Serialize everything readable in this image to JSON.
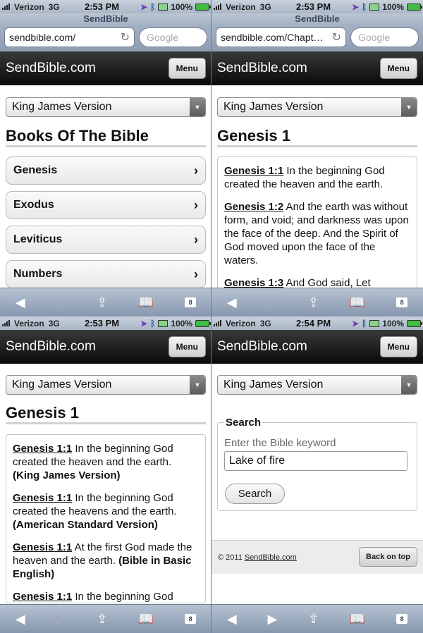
{
  "status": [
    {
      "carrier": "Verizon",
      "network": "3G",
      "time": "2:53 PM",
      "battery": "100%"
    },
    {
      "carrier": "Verizon",
      "network": "3G",
      "time": "2:53 PM",
      "battery": "100%"
    },
    {
      "carrier": "Verizon",
      "network": "3G",
      "time": "2:53 PM",
      "battery": "100%"
    },
    {
      "carrier": "Verizon",
      "network": "3G",
      "time": "2:54 PM",
      "battery": "100%"
    }
  ],
  "browser": [
    {
      "title": "SendBible",
      "url": "sendbible.com/",
      "search_placeholder": "Google"
    },
    {
      "title": "SendBible",
      "url": "sendbible.com/Chapt…",
      "search_placeholder": "Google"
    }
  ],
  "site": {
    "brand": "SendBible.com",
    "menu_label": "Menu",
    "version": "King James Version"
  },
  "books_page": {
    "heading": "Books Of The Bible",
    "books": [
      "Genesis",
      "Exodus",
      "Leviticus",
      "Numbers"
    ]
  },
  "chapter_page": {
    "heading": "Genesis 1",
    "verses": [
      {
        "ref": "Genesis 1:1",
        "text": " In the beginning God created the heaven and the earth."
      },
      {
        "ref": "Genesis 1:2",
        "text": " And the earth was without form, and void; and darkness was upon the face of the deep. And the Spirit of God moved upon the face of the waters."
      },
      {
        "ref": "Genesis 1:3",
        "text": " And God said, Let"
      }
    ]
  },
  "compare_page": {
    "heading": "Genesis 1",
    "verses": [
      {
        "ref": "Genesis 1:1",
        "text": " In the beginning God created the heaven and the earth.",
        "version": "(King James Version)"
      },
      {
        "ref": "Genesis 1:1",
        "text": " In the beginning God created the heavens and the earth.",
        "version": "(American Standard Version)"
      },
      {
        "ref": "Genesis 1:1",
        "text": " At the first God made the heaven and the earth. ",
        "version": "(Bible in Basic English)"
      },
      {
        "ref": "Genesis 1:1",
        "text": " In the beginning God",
        "version": ""
      }
    ]
  },
  "search_page": {
    "legend": "Search",
    "hint": "Enter the Bible keyword",
    "value": "Lake of fire",
    "button": "Search",
    "copyright": "© 2011",
    "copyright_link": "SendBible.com",
    "back_top": "Back on top"
  },
  "toolbar": {
    "tab_count": "8"
  }
}
